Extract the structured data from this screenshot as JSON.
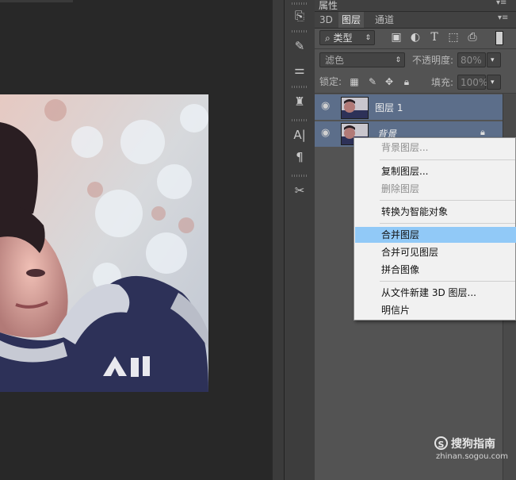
{
  "panel": {
    "properties_title": "属性",
    "tabs": [
      {
        "label": "3D",
        "active": false
      },
      {
        "label": "图层",
        "active": true
      },
      {
        "label": "通道",
        "active": false
      }
    ],
    "filter_kind": "类型",
    "filter_icons": [
      "image-filter-icon",
      "adjustment-filter-icon",
      "type-filter-icon",
      "shape-filter-icon",
      "smart-object-filter-icon"
    ],
    "blend_mode": "滤色",
    "opacity_label": "不透明度:",
    "opacity_value": "80%",
    "lock_label": "锁定:",
    "fill_label": "填充:",
    "fill_value": "100%",
    "layers": [
      {
        "name": "图层 1",
        "visible": true
      },
      {
        "name": "背景",
        "visible": true,
        "locked": true
      }
    ]
  },
  "context_menu": {
    "items": [
      {
        "label": "背景图层...",
        "disabled": true
      },
      {
        "label": "复制图层...",
        "disabled": false
      },
      {
        "label": "删除图层",
        "disabled": true
      },
      {
        "label": "转换为智能对象",
        "disabled": false
      },
      {
        "label": "合并图层",
        "disabled": false,
        "highlighted": true
      },
      {
        "label": "合并可见图层",
        "disabled": false
      },
      {
        "label": "拼合图像",
        "disabled": false
      },
      {
        "label": "从文件新建 3D 图层...",
        "disabled": false
      },
      {
        "label": "明信片",
        "disabled": false
      }
    ]
  },
  "watermark": {
    "brand": "搜狗指南",
    "url": "zhinan.sogou.com"
  },
  "colors": {
    "panel_bg": "#535353",
    "selected_layer": "#5c6e8a",
    "menu_highlight": "#91c9f7"
  }
}
